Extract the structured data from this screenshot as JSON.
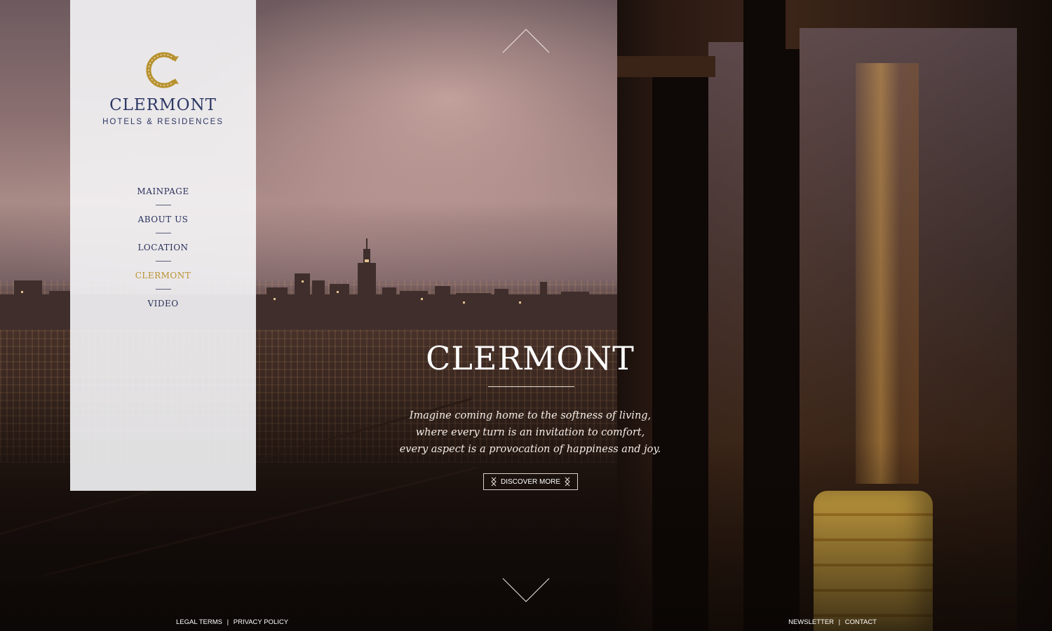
{
  "brand": {
    "name": "CLERMONT",
    "subtitle": "HOTELS & RESIDENCES",
    "logo_icon": "c-monogram-icon",
    "accent_color": "#b8922f",
    "navy_color": "#2c3863"
  },
  "nav": {
    "items": [
      {
        "label": "MAINPAGE"
      },
      {
        "label": "ABOUT US"
      },
      {
        "label": "LOCATION"
      },
      {
        "label": "CLERMONT",
        "active": true
      },
      {
        "label": "VIDEO"
      }
    ]
  },
  "hero": {
    "title": "CLERMONT",
    "lines": [
      "Imagine coming home to the softness of living,",
      "where every turn is an invitation to comfort,",
      "every aspect is a provocation of happiness and joy."
    ],
    "cta_label": "DISCOVER MORE"
  },
  "arrows": {
    "up_icon": "chevron-up-icon",
    "down_icon": "chevron-down-icon"
  },
  "footer": {
    "legal": "LEGAL TERMS",
    "privacy": "PRIVACY POLICY",
    "newsletter": "NEWSLETTER",
    "contact": "CONTACT",
    "separator": "|"
  }
}
